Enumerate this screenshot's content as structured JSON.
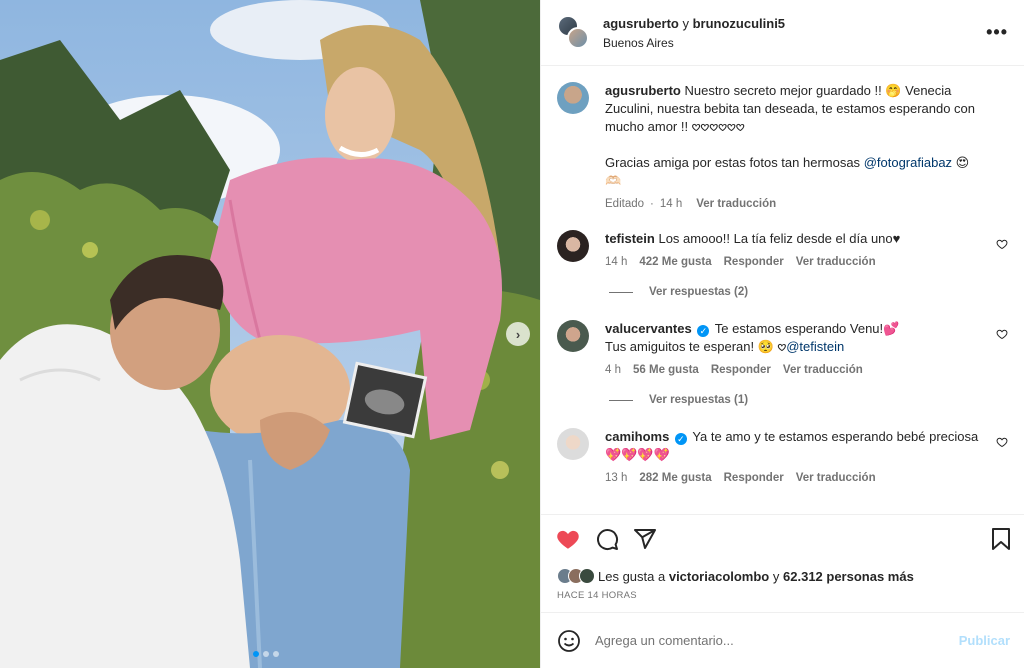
{
  "header": {
    "user1": "agusruberto",
    "joiner": "y",
    "user2": "brunozuculini5",
    "location": "Buenos Aires",
    "more_icon": "more-horizontal-icon"
  },
  "caption": {
    "username": "agusruberto",
    "text1": "Nuestro secreto mejor guardado !! 🤭 Venecia Zuculini, nuestra bebita tan deseada, te estamos esperando con mucho amor !! 𖹭𖹭𖹭𖹭𖹭𖹭",
    "text2": "Gracias amiga por estas fotos tan hermosas",
    "mention": "@fotografiabaz",
    "text2_emoji": "😍 🫶🏻",
    "edited": "Editado",
    "time": "14 h",
    "translate": "Ver traducción"
  },
  "comments": [
    {
      "username": "tefistein",
      "text": "Los amooo!! La tía feliz desde el día uno♥",
      "time": "14 h",
      "likes": "422 Me gusta",
      "reply": "Responder",
      "translate": "Ver traducción",
      "replies": "Ver respuestas (2)"
    },
    {
      "username": "valucervantes",
      "verified": true,
      "text": "Te estamos esperando Venu!💕",
      "text_line2": "Tus amiguitos te esperan! 🥺 𖹭",
      "mention": "@tefistein",
      "time": "4 h",
      "likes": "56 Me gusta",
      "reply": "Responder",
      "translate": "Ver traducción",
      "replies": "Ver respuestas (1)"
    },
    {
      "username": "camihoms",
      "verified": true,
      "text": "Ya te amo y te estamos esperando bebé preciosa",
      "text_line2": "💖💖💖💖",
      "time": "13 h",
      "likes": "282 Me gusta",
      "reply": "Responder",
      "translate": "Ver traducción"
    }
  ],
  "likes": {
    "prefix": "Les gusta a",
    "user": "victoriacolombo",
    "joiner": "y",
    "count": "62.312 personas más"
  },
  "timestamp": "HACE 14 HORAS",
  "add_comment": {
    "placeholder": "Agrega un comentario...",
    "publish": "Publicar"
  },
  "carousel": {
    "total": 3,
    "active": 1
  },
  "colors": {
    "like": "#ed4956",
    "link": "#00376b",
    "accent": "#0095f6",
    "publish_disabled": "#b2dffc"
  }
}
